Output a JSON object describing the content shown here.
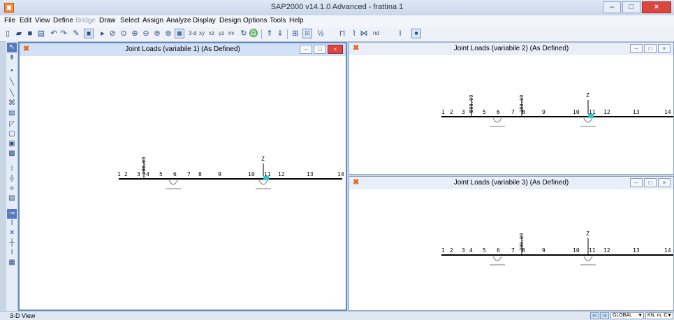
{
  "app": {
    "title": "SAP2000 v14.1.0 Advanced  - frattina 1"
  },
  "window_controls": {
    "minimize": "–",
    "maximize": "□",
    "close": "×"
  },
  "menu": [
    {
      "label": "File",
      "enabled": true
    },
    {
      "label": "Edit",
      "enabled": true
    },
    {
      "label": "View",
      "enabled": true
    },
    {
      "label": "Define",
      "enabled": true
    },
    {
      "label": "Bridge",
      "enabled": false
    },
    {
      "label": "Draw",
      "enabled": true
    },
    {
      "label": "Select",
      "enabled": true
    },
    {
      "label": "Assign",
      "enabled": true
    },
    {
      "label": "Analyze",
      "enabled": true
    },
    {
      "label": "Display",
      "enabled": true
    },
    {
      "label": "Design",
      "enabled": true
    },
    {
      "label": "Options",
      "enabled": true
    },
    {
      "label": "Tools",
      "enabled": true
    },
    {
      "label": "Help",
      "enabled": true
    }
  ],
  "toolbar": {
    "view_3d": "3-d",
    "view_xy": "xy",
    "view_xz": "xz",
    "view_yz": "yz",
    "view_nv": "nv",
    "view_nd": "nd"
  },
  "views": [
    {
      "title": "Joint Loads (variabile 1) (As Defined)",
      "active": true,
      "joints": [
        "1",
        "2",
        "3",
        "4",
        "5",
        "6",
        "7",
        "8",
        "9",
        "10",
        "11",
        "12",
        "13",
        "14"
      ],
      "load_labels": [
        "200.00"
      ],
      "axis_label": "Z"
    },
    {
      "title": "Joint Loads (variabile 2) (As Defined)",
      "active": false,
      "joints": [
        "1",
        "2",
        "3",
        "4",
        "5",
        "6",
        "7",
        "8",
        "9",
        "10",
        "11",
        "12",
        "13",
        "14"
      ],
      "load_labels": [
        "200.00",
        "200.00"
      ],
      "axis_label": "Z"
    },
    {
      "title": "Joint Loads (variabile 3) (As Defined)",
      "active": false,
      "joints": [
        "1",
        "2",
        "3",
        "4",
        "5",
        "6",
        "7",
        "8",
        "9",
        "10",
        "11",
        "12",
        "13",
        "14"
      ],
      "load_labels": [
        "200.00"
      ],
      "axis_label": "Z"
    }
  ],
  "status": {
    "text": "3-D View",
    "coord_system": "GLOBAL",
    "units": "KN, m, C"
  },
  "icons": {
    "app": "sap2000-app-icon",
    "view": "sap2000-view-icon",
    "pointer": "pointer-icon",
    "draw_frame": "draw-frame-icon",
    "nav_left": "arrow-left-icon",
    "nav_right": "arrow-right-icon"
  }
}
